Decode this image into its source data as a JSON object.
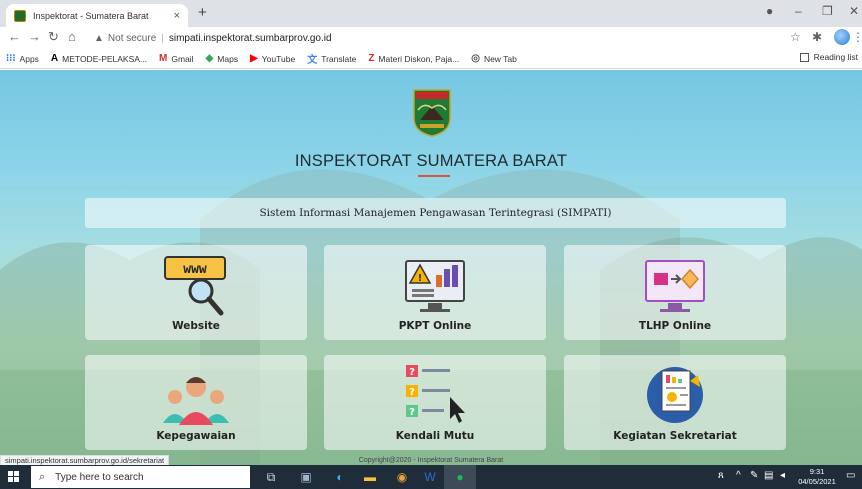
{
  "browser": {
    "tab_title": "Inspektorat - Sumatera Barat",
    "tab_close": "×",
    "new_tab": "+",
    "security_label": "Not secure",
    "url": "simpati.inspektorat.sumbarprov.go.id",
    "bookmarks": [
      {
        "label": "Apps",
        "icon": "apps-grid-icon"
      },
      {
        "label": "METODE-PELAKSA...",
        "icon": "a-logo-icon"
      },
      {
        "label": "Gmail",
        "icon": "gmail-icon"
      },
      {
        "label": "Maps",
        "icon": "maps-icon"
      },
      {
        "label": "YouTube",
        "icon": "youtube-icon"
      },
      {
        "label": "Translate",
        "icon": "translate-icon"
      },
      {
        "label": "Materi Diskon, Paja...",
        "icon": "z-logo-icon"
      },
      {
        "label": "New Tab",
        "icon": "newtab-icon"
      }
    ],
    "reading_list": "Reading list",
    "status_url": "simpati.inspektorat.sumbarprov.go.id/sekretariat"
  },
  "page": {
    "title": "INSPEKTORAT SUMATERA BARAT",
    "subtitle": "Sistem Informasi Manajemen Pengawasan Terintegrasi (SIMPATI)",
    "cards": [
      {
        "label": "Website",
        "icon": "www-magnifier-icon"
      },
      {
        "label": "PKPT Online",
        "icon": "warning-chart-monitor-icon"
      },
      {
        "label": "TLHP Online",
        "icon": "monitor-transfer-icon"
      },
      {
        "label": "Kepegawaian",
        "icon": "people-group-icon"
      },
      {
        "label": "Kendali Mutu",
        "icon": "question-list-cursor-icon"
      },
      {
        "label": "Kegiatan Sekretariat",
        "icon": "report-document-icon"
      }
    ],
    "footer": "Copyright@2020 - Inspektorat Sumatera Barat"
  },
  "taskbar": {
    "search_placeholder": "Type here to search",
    "time": "9:31",
    "date": "04/05/2021"
  },
  "colors": {
    "accent_underline": "#e0553a",
    "taskbar": "#1f2d3a"
  }
}
